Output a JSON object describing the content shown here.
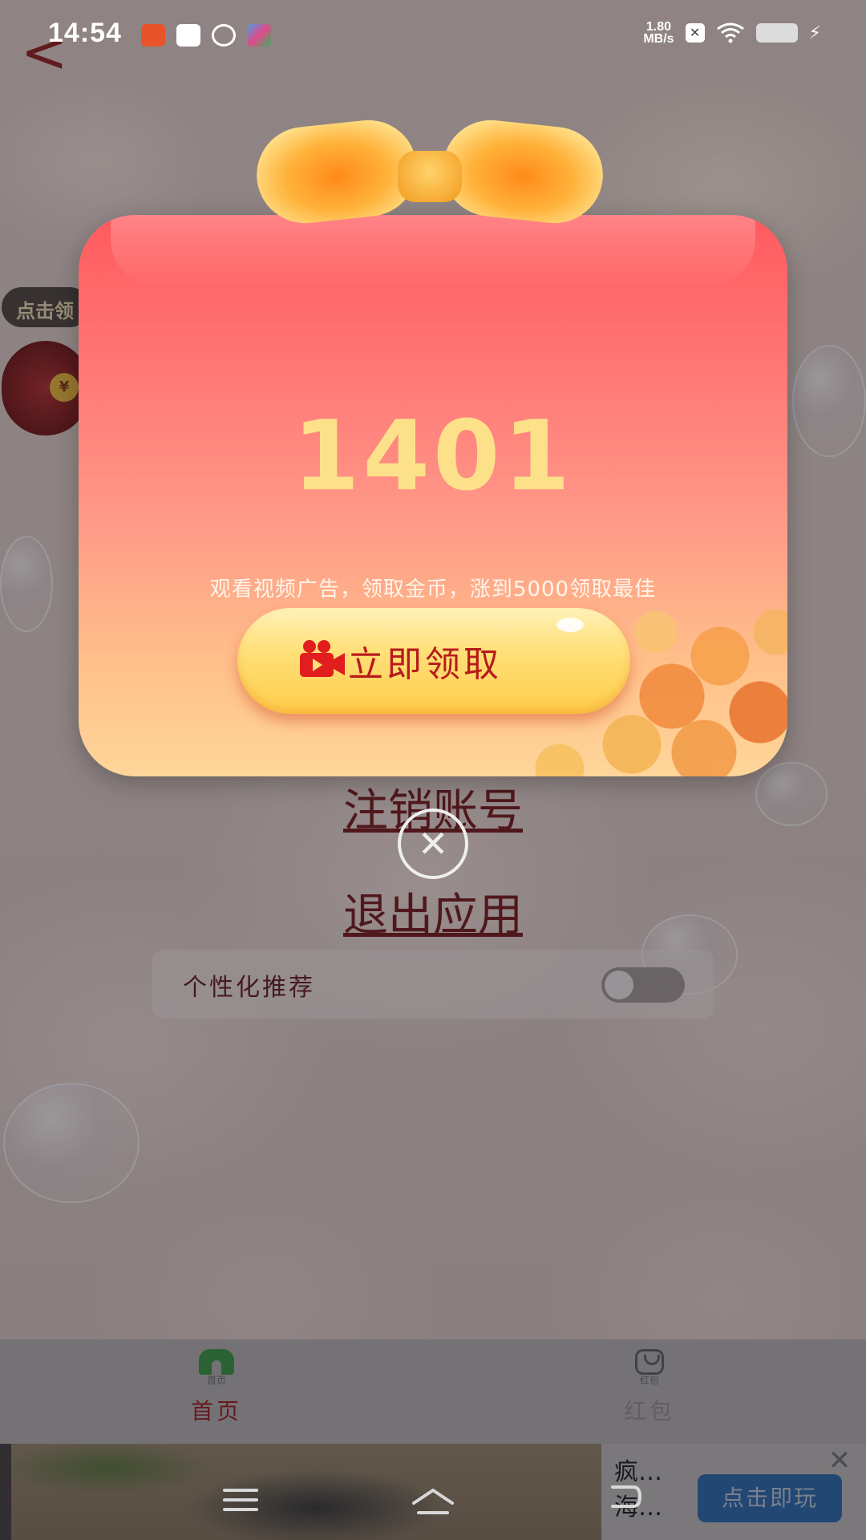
{
  "status_bar": {
    "time": "14:54",
    "net_speed_value": "1.80",
    "net_speed_unit": "MB/s",
    "icons": [
      "app-notification-icon",
      "mail-icon",
      "planet-icon",
      "game-icon",
      "sim-off-icon",
      "wifi-icon",
      "battery-icon",
      "charging-icon"
    ]
  },
  "page": {
    "back_icon": "chevron-left-icon",
    "claim_tip": "点击领",
    "settings": {
      "cancel_account": "注销账号",
      "exit_app": "退出应用",
      "personalized_label": "个性化推荐",
      "personalized_enabled": false
    }
  },
  "popup": {
    "coin_count": "1401",
    "description": "观看视频广告，领取金币，涨到5000领取最佳",
    "claim_button_label": "立即领取",
    "claim_button_icon": "video-camera-icon",
    "close_icon": "close-circle-icon"
  },
  "bottom_nav": {
    "items": [
      {
        "label": "首页",
        "sub": "首页",
        "icon": "home-icon",
        "active": true
      },
      {
        "label": "红包",
        "sub": "红包",
        "icon": "red-packet-icon",
        "active": false
      }
    ]
  },
  "ad": {
    "title_line1": "疯…",
    "title_line2": "海…",
    "cta": "点击即玩",
    "close_icon": "close-icon"
  },
  "colors": {
    "popup_top": "#ff5a5e",
    "popup_bottom": "#ffd69a",
    "coin_text": "#fde18a",
    "claim_text": "#b71b1b",
    "link_dark_red": "#6d0d0d",
    "ad_cta": "#1e5ea3"
  }
}
